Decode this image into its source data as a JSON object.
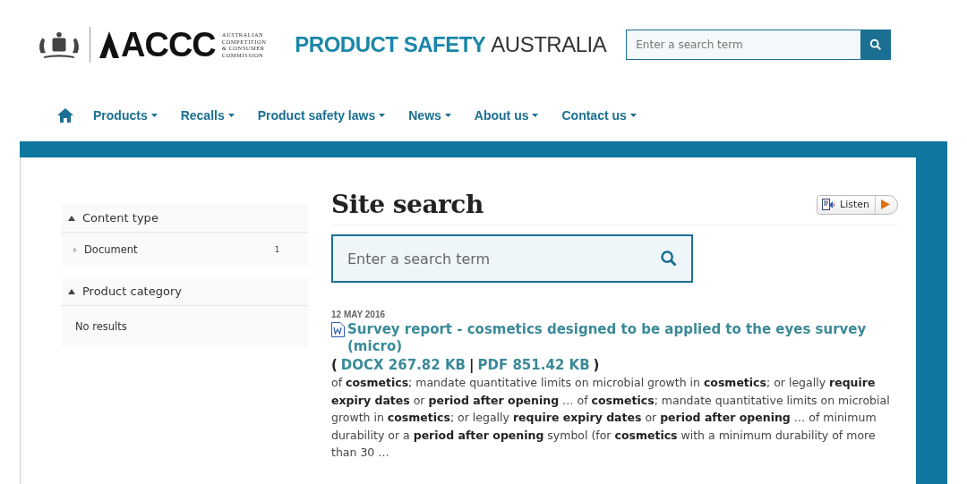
{
  "header": {
    "logo_main": "ACCC",
    "logo_sub": [
      "AUSTRALIAN",
      "COMPETITION",
      "& CONSUMER",
      "COMMISSION"
    ],
    "site_title_part1": "PRODUCT SAFETY",
    "site_title_part2": "AUSTRALIA",
    "search": {
      "placeholder": "Enter a search term"
    }
  },
  "nav": [
    {
      "label": "Products",
      "dropdown": true
    },
    {
      "label": "Recalls",
      "dropdown": true
    },
    {
      "label": "Product safety laws",
      "dropdown": true
    },
    {
      "label": "News",
      "dropdown": true
    },
    {
      "label": "About us",
      "dropdown": true
    },
    {
      "label": "Contact us",
      "dropdown": true
    }
  ],
  "facets": [
    {
      "title": "Content type",
      "expanded": true,
      "items": [
        {
          "label": "Document",
          "count": "1"
        }
      ]
    },
    {
      "title": "Product category",
      "expanded": true,
      "empty_text": "No results"
    }
  ],
  "page_title": "Site search",
  "listen": {
    "label": "Listen"
  },
  "search": {
    "placeholder": "Enter a search term"
  },
  "results": [
    {
      "date": "12 MAY 2016",
      "title": "Survey report - cosmetics designed to be applied to the eyes survey (micro)",
      "files": [
        "DOCX 267.82 KB",
        "PDF 851.42 KB"
      ],
      "open": "(",
      "separator": "|",
      "close": ")",
      "snippet": "of **cosmetics**; mandate quantitative limits on microbial growth in **cosmetics**; or legally **require expiry dates** or **period after opening** … of **cosmetics**; mandate quantitative limits on microbial growth in **cosmetics**; or legally **require expiry dates** or **period after opening** … of minimum durability or a **period after opening** symbol (for **cosmetics** with a minimum durability of more than 30 …"
    }
  ]
}
